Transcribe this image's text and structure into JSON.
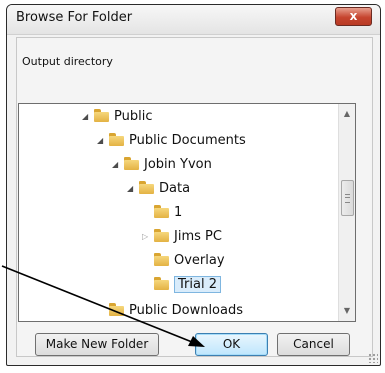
{
  "window": {
    "title": "Browse For Folder",
    "close_label": "x",
    "description": "Output directory"
  },
  "tree": {
    "items": [
      {
        "label": "Public",
        "expander": "expanded",
        "selected": false
      },
      {
        "label": "Public Documents",
        "expander": "expanded",
        "selected": false
      },
      {
        "label": "Jobin Yvon",
        "expander": "expanded",
        "selected": false
      },
      {
        "label": "Data",
        "expander": "expanded",
        "selected": false
      },
      {
        "label": "1",
        "expander": "none",
        "selected": false
      },
      {
        "label": "Jims PC",
        "expander": "collapsed",
        "selected": false
      },
      {
        "label": "Overlay",
        "expander": "none",
        "selected": false
      },
      {
        "label": "Trial 2",
        "expander": "none",
        "selected": true
      },
      {
        "label": "Public Downloads",
        "expander": "none",
        "selected": false
      }
    ]
  },
  "buttons": {
    "make_new_folder": "Make New Folder",
    "ok": "OK",
    "cancel": "Cancel"
  },
  "icons": {
    "folder": "folder-icon",
    "expanded": "triangle-down-icon",
    "collapsed": "triangle-right-icon"
  },
  "colors": {
    "selection_bg": "#d9ecfb",
    "selection_border": "#7fb6e0",
    "close_button": "#c6452f"
  }
}
